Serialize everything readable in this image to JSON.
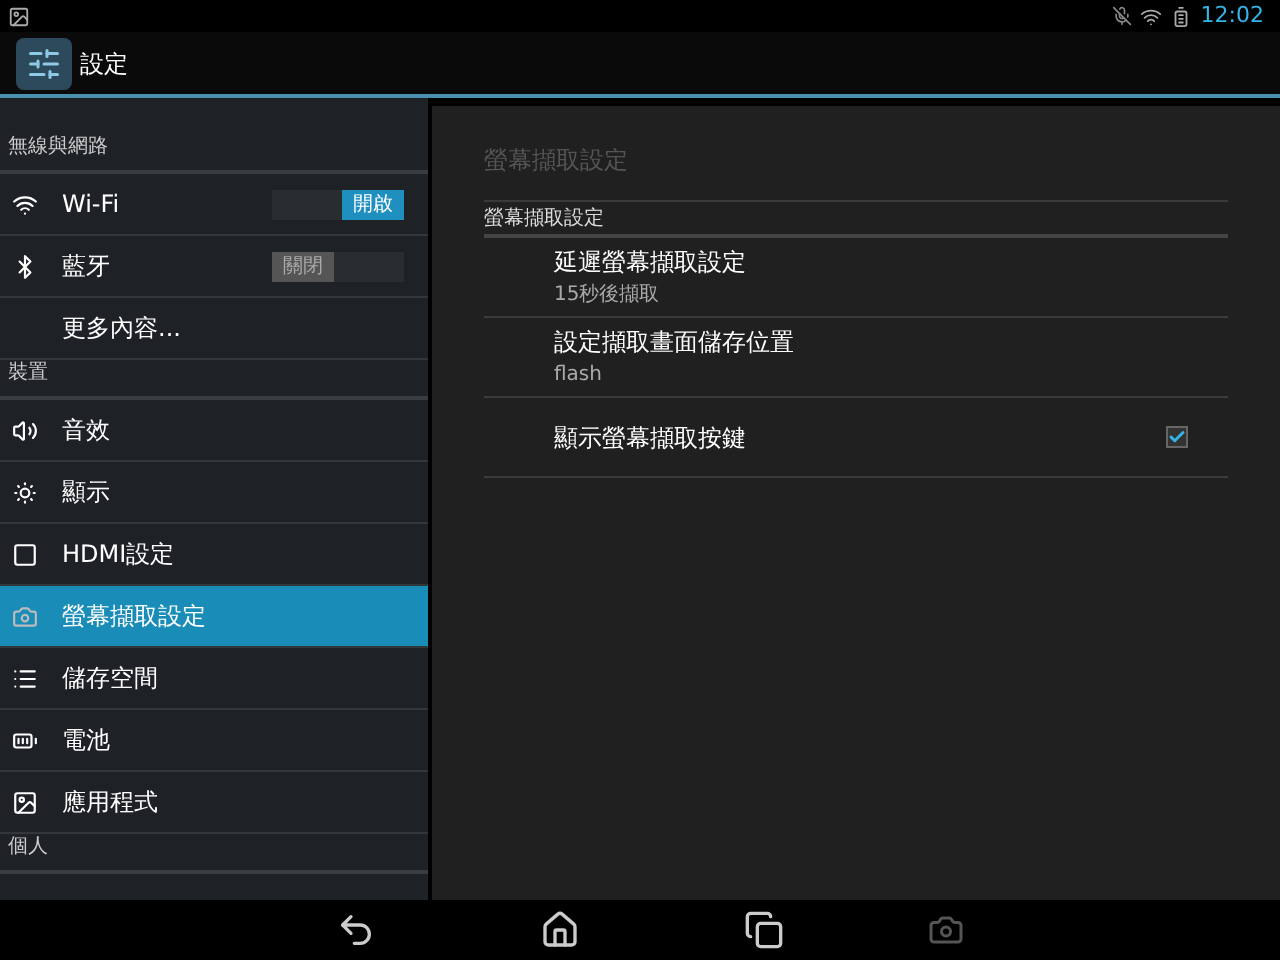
{
  "status_bar": {
    "time": "12:02"
  },
  "action_bar": {
    "title": "設定"
  },
  "sidebar": {
    "sections": [
      {
        "header": "無線與網路",
        "items": [
          {
            "label": "Wi-Fi",
            "kind": "toggle",
            "on": true,
            "toggle_label": "開啟",
            "selected": false
          },
          {
            "label": "藍牙",
            "kind": "toggle",
            "on": false,
            "toggle_label": "關閉",
            "selected": false
          },
          {
            "label": "更多內容...",
            "kind": "plain",
            "selected": false
          }
        ]
      },
      {
        "header": "裝置",
        "items": [
          {
            "label": "音效",
            "kind": "plain",
            "selected": false
          },
          {
            "label": "顯示",
            "kind": "plain",
            "selected": false
          },
          {
            "label": "HDMI設定",
            "kind": "plain",
            "selected": false
          },
          {
            "label": "螢幕擷取設定",
            "kind": "plain",
            "selected": true
          },
          {
            "label": "儲存空間",
            "kind": "plain",
            "selected": false
          },
          {
            "label": "電池",
            "kind": "plain",
            "selected": false
          },
          {
            "label": "應用程式",
            "kind": "plain",
            "selected": false
          }
        ]
      },
      {
        "header": "個人"
      }
    ]
  },
  "detail": {
    "title": "螢幕擷取設定",
    "category": "螢幕擷取設定",
    "items": [
      {
        "kind": "text",
        "title": "延遲螢幕擷取設定",
        "summary": "15秒後擷取"
      },
      {
        "kind": "text",
        "title": "設定擷取畫面儲存位置",
        "summary": "flash"
      },
      {
        "kind": "checkbox",
        "title": "顯示螢幕擷取按鍵",
        "checked": true
      }
    ]
  }
}
